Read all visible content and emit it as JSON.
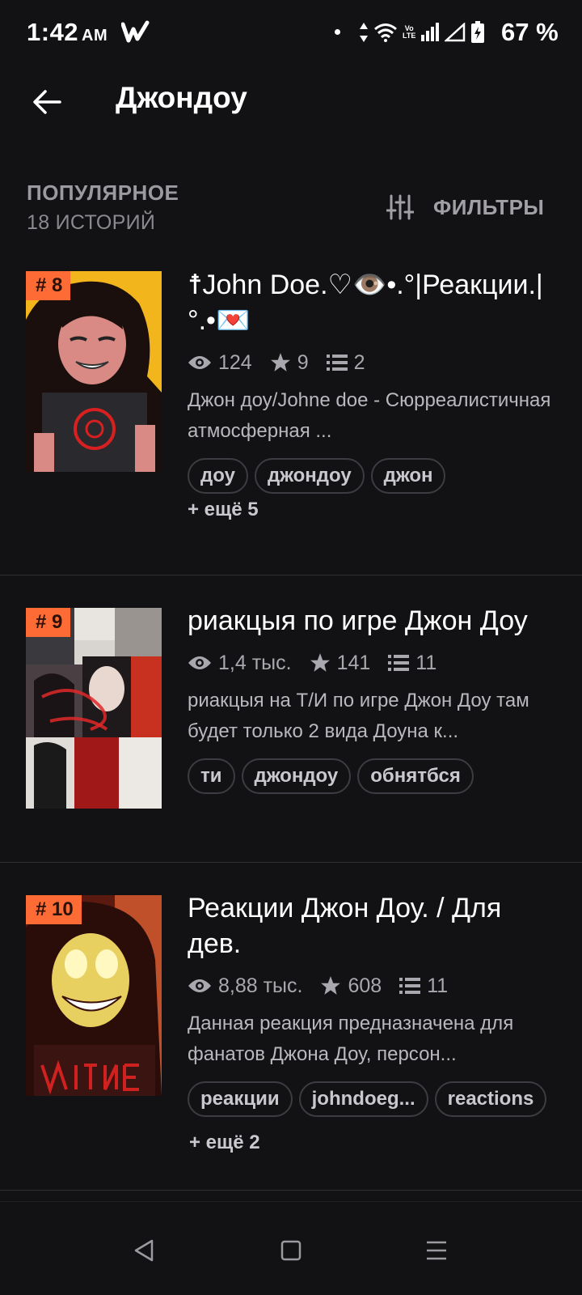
{
  "status_bar": {
    "time": "1:42",
    "ampm": "AM",
    "app_icon": "wattpad-w-icon",
    "volte_top": "Vo",
    "volte_bottom": "LTE",
    "battery": "67 %"
  },
  "header": {
    "title": "Джондоу",
    "back_icon": "back-arrow-icon"
  },
  "sort": {
    "label": "ПОПУЛЯРНОЕ",
    "count": "18 ИСТОРИЙ",
    "filter_label": "ФИЛЬТРЫ",
    "filter_icon": "sliders-icon"
  },
  "stories": [
    {
      "rank": "# 8",
      "title": "☨John Doe.♡👁️•.°|Реакции.|°.•💌",
      "views": "124",
      "votes": "9",
      "parts": "2",
      "description": "Джон доу/Johne doe - Сюрреалистичная атмосферная ...",
      "tags": [
        "доу",
        "джондоу",
        "джон"
      ],
      "more": "+ ещё 5"
    },
    {
      "rank": "# 9",
      "title": "риакцыя по игре Джон Доу",
      "views": "1,4 тыс.",
      "votes": "141",
      "parts": "11",
      "description": "риакцыя на Т/И по игре Джон Доу там будет только 2 вида Доуна к...",
      "tags": [
        "ти",
        "джондоу",
        "обнятбся"
      ],
      "more": ""
    },
    {
      "rank": "# 10",
      "title": "Реакции Джон Доу. / Для дев.",
      "views": "8,88 тыс.",
      "votes": "608",
      "parts": "11",
      "description": "Данная реакция предназначена для фанатов Джона Доу, персон...",
      "tags": [
        "реакции",
        "johndoeg...",
        "reactions"
      ],
      "more": "+ ещё 2"
    }
  ],
  "colors": {
    "background": "#121214",
    "rank_badge": "#ff6b35",
    "secondary_text": "#a8a8ae"
  }
}
